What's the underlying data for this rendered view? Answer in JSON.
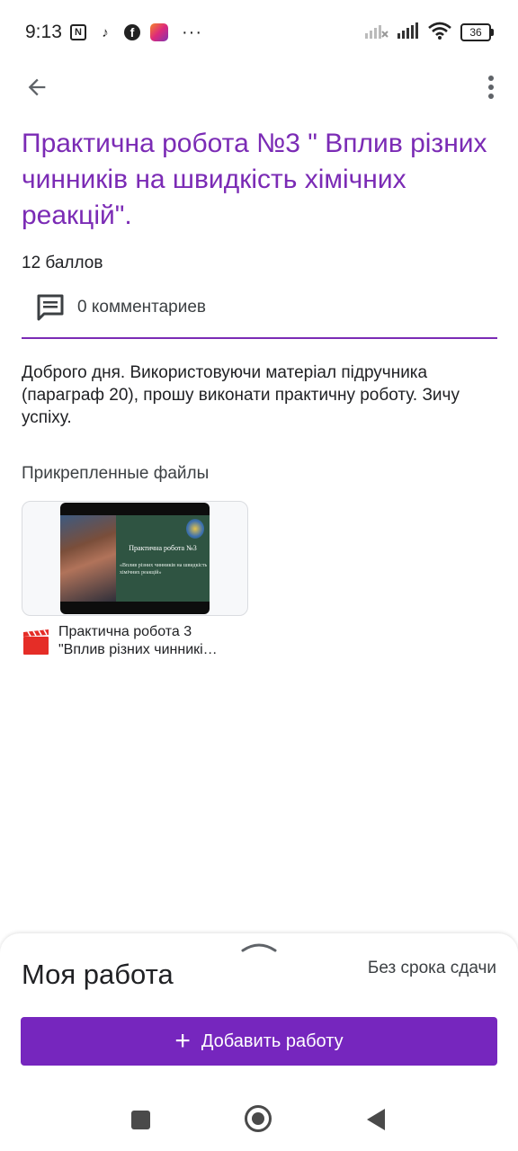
{
  "status_bar": {
    "time": "9:13",
    "battery": "36",
    "icons": [
      "nfc-icon",
      "tiktok-icon",
      "facebook-icon",
      "app-icon",
      "more-dots-icon",
      "signal-icon",
      "wifi-icon",
      "battery-icon"
    ],
    "dots": "···"
  },
  "header": {
    "back_icon": "arrow-back-icon",
    "more_icon": "more-vert-icon"
  },
  "assignment": {
    "title": "Практична робота №3 \" Вплив різних чинників на швидкість хімічних реакцій\".",
    "points": "12 баллов",
    "comments": "0 комментариев",
    "description": "Доброго дня. Використовуючи матеріал підручника (параграф 20), прошу виконати практичну роботу. Зичу успіху."
  },
  "attachments": {
    "heading": "Прикрепленные файлы",
    "files": [
      {
        "name_line1": "Практична робота 3",
        "name_line2": "\"Вплив різних чинникі…",
        "thumb_title": "Практична робота №3",
        "thumb_subtitle": "«Вплив різних чинників на швидкість хімічних реакцій»",
        "icon": "video-file-icon"
      }
    ]
  },
  "my_work": {
    "title": "Моя работа",
    "due": "Без срока сдачи",
    "add_button": "Добавить работу"
  },
  "colors": {
    "accent": "#7b2bb5",
    "button": "#7626be",
    "video_icon": "#e52d27"
  }
}
